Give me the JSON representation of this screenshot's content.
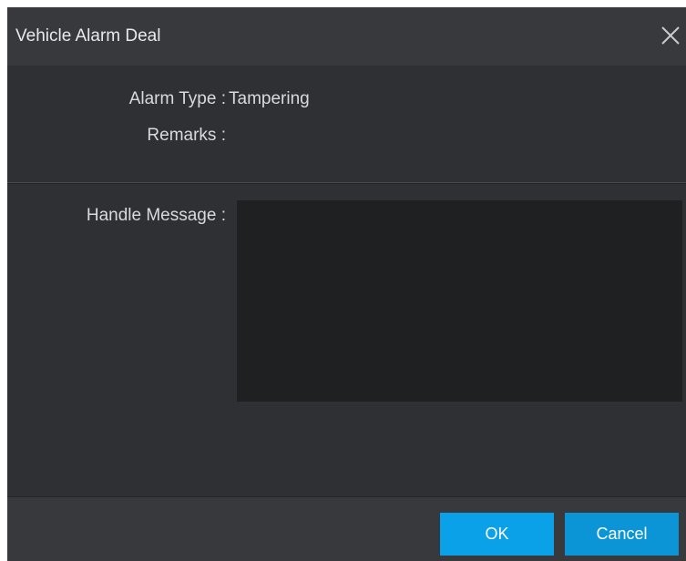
{
  "dialog": {
    "title": "Vehicle Alarm Deal",
    "close_icon": "close-icon"
  },
  "info": {
    "alarm_type_label": "Alarm Type :",
    "alarm_type_value": "Tampering",
    "remarks_label": "Remarks :",
    "remarks_value": ""
  },
  "handle": {
    "label": "Handle Message :",
    "value": ""
  },
  "footer": {
    "ok_label": "OK",
    "cancel_label": "Cancel"
  },
  "colors": {
    "dialog_bg": "#2e3033",
    "header_bg": "#37393c",
    "input_bg": "#1e2022",
    "accent": "#0aa1e8"
  }
}
